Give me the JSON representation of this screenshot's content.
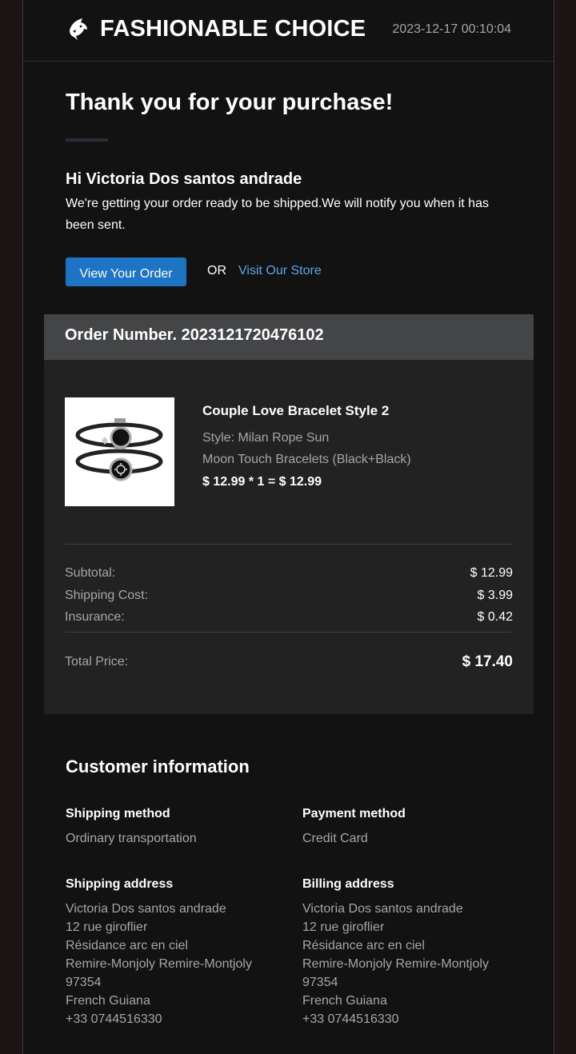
{
  "header": {
    "brand": "FASHIONABLE CHOICE",
    "timestamp": "2023-12-17 00:10:04",
    "logo_icon": "shark-icon"
  },
  "intro": {
    "headline": "Thank you for your purchase!",
    "greeting": "Hi Victoria Dos santos andrade",
    "message": "We're getting your order ready to be shipped.We will notify you when it has been sent.",
    "view_order_label": "View Your Order",
    "or_label": "OR",
    "visit_store_label": "Visit Our Store"
  },
  "order": {
    "number_label": "Order Number. 2023121720476102",
    "product": {
      "title": "Couple Love Bracelet Style 2",
      "style_line1": "Style: Milan Rope Sun",
      "style_line2": "Moon Touch Bracelets (Black+Black)",
      "price_line": "$ 12.99 * 1 = $ 12.99",
      "image_icon": "bracelet-image"
    },
    "summary": {
      "subtotal_label": "Subtotal:",
      "subtotal_value": "$ 12.99",
      "shipping_label": "Shipping Cost:",
      "shipping_value": "$ 3.99",
      "insurance_label": "Insurance:",
      "insurance_value": "$ 0.42",
      "total_label": "Total Price:",
      "total_value": "$ 17.40"
    }
  },
  "customer": {
    "title": "Customer information",
    "shipping_method_label": "Shipping method",
    "shipping_method_value": "Ordinary transportation",
    "payment_method_label": "Payment method",
    "payment_method_value": "Credit Card",
    "shipping_address_label": "Shipping address",
    "billing_address_label": "Billing address",
    "shipping_address": [
      "Victoria Dos santos andrade",
      "12 rue giroflier",
      "Résidance arc en ciel",
      "Remire-Monjoly Remire-Montjoly",
      "97354",
      "French Guiana",
      "+33 0744516330"
    ],
    "billing_address": [
      "Victoria Dos santos andrade",
      "12 rue giroflier",
      "Résidance arc en ciel",
      "Remire-Monjoly Remire-Montjoly",
      "97354",
      "French Guiana",
      "+33 0744516330"
    ]
  },
  "colors": {
    "page_bg": "#1b1414",
    "panel_bg": "#121212",
    "order_bg": "#222222",
    "order_head_bg": "#444547",
    "button_blue": "#1d74c4",
    "link_blue": "#5aa6e8",
    "muted_text": "#a6a6a6"
  }
}
